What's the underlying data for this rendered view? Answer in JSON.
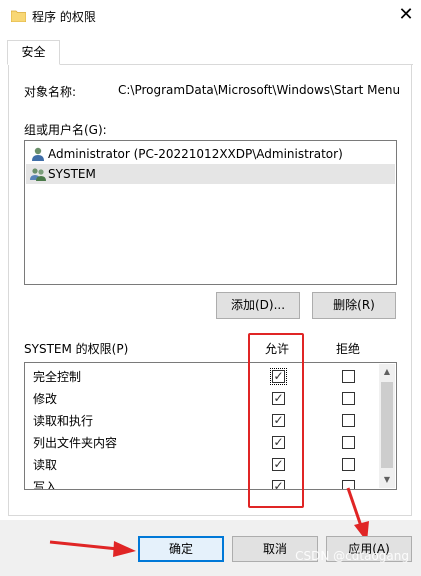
{
  "window": {
    "title": "程序 的权限",
    "close_glyph": "✕"
  },
  "tabs": [
    {
      "label": "安全"
    }
  ],
  "object": {
    "label": "对象名称:",
    "path": "C:\\ProgramData\\Microsoft\\Windows\\Start Menu"
  },
  "users": {
    "label": "组或用户名(G):",
    "items": [
      {
        "name": "Administrator (PC-20221012XXDP\\Administrator)",
        "icon": "user-icon",
        "selected": false
      },
      {
        "name": "SYSTEM",
        "icon": "users-group-icon",
        "selected": true
      }
    ]
  },
  "user_buttons": {
    "add": "添加(D)...",
    "remove": "删除(R)"
  },
  "permissions": {
    "label": "SYSTEM 的权限(P)",
    "allow_header": "允许",
    "deny_header": "拒绝",
    "rows": [
      {
        "name": "完全控制",
        "allow": "✓",
        "deny": ""
      },
      {
        "name": "修改",
        "allow": "✓",
        "deny": ""
      },
      {
        "name": "读取和执行",
        "allow": "✓",
        "deny": ""
      },
      {
        "name": "列出文件夹内容",
        "allow": "✓",
        "deny": ""
      },
      {
        "name": "读取",
        "allow": "✓",
        "deny": ""
      },
      {
        "name": "写入",
        "allow": "✓",
        "deny": ""
      }
    ]
  },
  "buttons": {
    "ok": "确定",
    "cancel": "取消",
    "apply": "应用(A)"
  },
  "watermark": "CSDN @cdtaogang",
  "colors": {
    "annotation": "#e02525",
    "selection": "#e5e5e5",
    "focus": "#0078d7"
  }
}
